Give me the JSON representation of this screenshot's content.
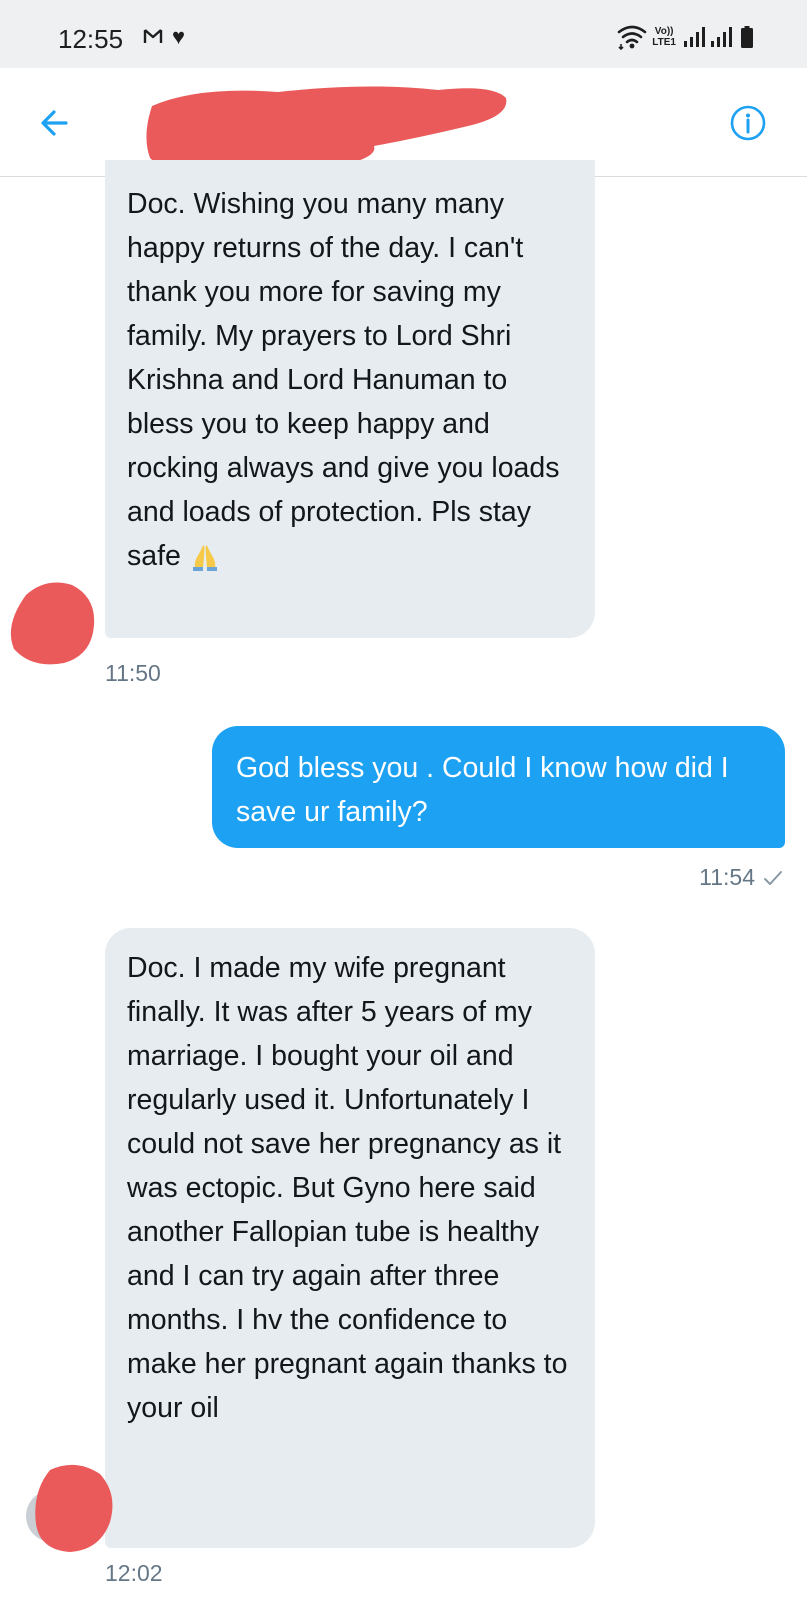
{
  "status_bar": {
    "time": "12:55",
    "notification_icons": [
      "gmail-icon",
      "heart-icon"
    ],
    "right_icons": [
      "wifi-icon",
      "volte-icon",
      "signal-icon",
      "signal-icon",
      "battery-icon"
    ],
    "volte_top": "Vo))",
    "volte_bottom": "LTE1"
  },
  "header": {
    "back_icon": "arrow-left-icon",
    "info_icon": "info-icon",
    "accent_color": "#1da1f2"
  },
  "messages": [
    {
      "direction": "incoming",
      "text": "Doc. Wishing you many many happy returns of the day. I can't thank you more for saving my family. My prayers to Lord Shri Krishna and Lord Hanuman to bless you to keep happy and rocking always and give you loads and loads of protection. Pls stay safe",
      "emoji": "🙏",
      "time": "11:50"
    },
    {
      "direction": "outgoing",
      "text": "God bless you . Could I know how did I save ur family?",
      "time": "11:54",
      "status": "✓"
    },
    {
      "direction": "incoming",
      "text": "Doc. I made my wife pregnant finally. It was after 5 years of my marriage. I bought your oil and regularly used it. Unfortunately I could not save her pregnancy as it was ectopic. But Gyno here said another Fallopian tube is healthy and I can try again after three months. I hv the confidence to make her pregnant again thanks to your oil",
      "time": "12:02"
    }
  ],
  "colors": {
    "incoming_bubble": "#e6ecf0",
    "outgoing_bubble": "#1da1f2",
    "redaction": "#ea5a5a",
    "timestamp": "#657786"
  }
}
